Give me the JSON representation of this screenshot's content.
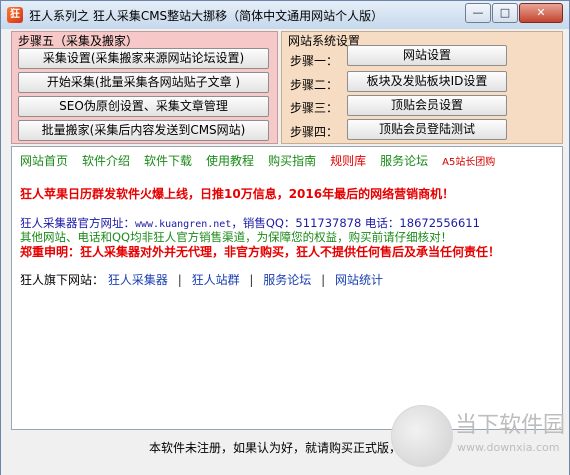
{
  "window": {
    "title": "狂人系列之 狂人采集CMS整站大挪移（简体中文通用网站个人版）",
    "icon_text": "狂",
    "buttons": {
      "minimize": "—",
      "maximize": "□",
      "close": "✕"
    }
  },
  "step5": {
    "label": "步骤五（采集及搬家）",
    "buttons": [
      "采集设置(采集搬家来源网站论坛设置)",
      "开始采集(批量采集各网站贴子文章 )",
      "SEO伪原创设置、采集文章管理",
      "批量搬家(采集后内容发送到CMS网站)"
    ]
  },
  "netsys": {
    "label": "网站系统设置",
    "rows": [
      {
        "step": "步骤一：",
        "button": "网站设置"
      },
      {
        "step": "步骤二：",
        "button": "板块及发贴板块ID设置"
      },
      {
        "step": "步骤三：",
        "button": "顶贴会员设置"
      },
      {
        "step": "步骤四：",
        "button": "顶贴会员登陆测试"
      }
    ]
  },
  "nav": [
    "网站首页",
    "软件介绍",
    "软件下载",
    "使用教程",
    "购买指南",
    "规则库",
    "服务论坛",
    "A5站长团购"
  ],
  "announcement": "狂人苹果日历群发软件火爆上线，日推10万信息，2016年最后的网络营销商机！",
  "official": {
    "prefix": "狂人采集器官方网址：",
    "url": "www.kuangren.net",
    "rest": "，销售QQ：511737878  电话：18672556611"
  },
  "channels_note": "其他网站、电话和QQ均非狂人官方销售渠道，为保障您的权益，购买前请仔细核对！",
  "disclaimer": "郑重申明：狂人采集器对外并无代理，非官方购买，狂人不提供任何售后及承当任何责任！",
  "sites": {
    "label": "狂人旗下网站：",
    "links": [
      "狂人采集器",
      "狂人站群",
      "服务论坛",
      "网站统计"
    ],
    "separator": "|"
  },
  "status": "本软件未注册，如果认为好，就请购买正式版，谢谢",
  "watermark": {
    "title": "当下软件园",
    "sub": "www.downxia.com"
  }
}
